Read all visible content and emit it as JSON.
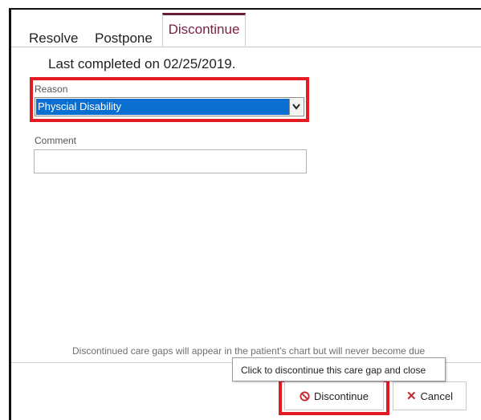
{
  "tabs": [
    {
      "label": "Resolve"
    },
    {
      "label": "Postpone"
    },
    {
      "label": "Discontinue"
    }
  ],
  "active_tab": "Discontinue",
  "last_completed": "Last completed on 02/25/2019.",
  "reason": {
    "label": "Reason",
    "selected_value": "Physcial Disability"
  },
  "comment": {
    "label": "Comment",
    "value": ""
  },
  "footer_note": "Discontinued care gaps will appear in the patient's chart but will never become due",
  "tooltip": "Click to discontinue this care gap and close",
  "buttons": {
    "discontinue_label": "Discontinue",
    "cancel_label": "Cancel"
  },
  "icons": {
    "discontinue": "ban-icon",
    "cancel": "x-icon"
  },
  "colors": {
    "accent": "#6b1b3a",
    "active_tab_text": "#7a1e44",
    "highlight": "#e31b23",
    "selection": "#0a6fd1",
    "cancel_icon": "#c4262e"
  }
}
